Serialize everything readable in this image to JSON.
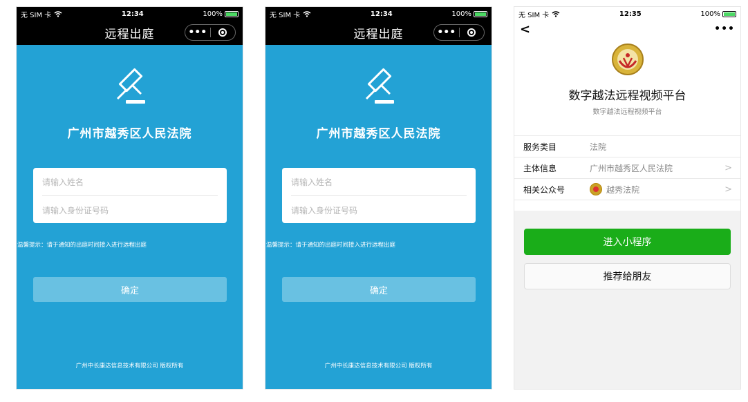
{
  "panels": [
    {
      "status": {
        "carrier": "无 SIM 卡",
        "time": "12:34",
        "battery": "100%"
      },
      "title": "远程出庭",
      "court": "广州市越秀区人民法院",
      "name_placeholder": "请输入姓名",
      "id_placeholder": "请输入身份证号码",
      "tip": "温馨提示：请于通知的出庭时间接入进行远程出庭",
      "confirm": "确定",
      "copyright": "广州中长康达信息技术有限公司 版权所有"
    },
    {
      "status": {
        "carrier": "无 SIM 卡",
        "time": "12:34",
        "battery": "100%"
      },
      "title": "远程出庭",
      "court": "广州市越秀区人民法院",
      "name_placeholder": "请输入姓名",
      "id_placeholder": "请输入身份证号码",
      "tip": "温馨提示：请于通知的出庭时间接入进行远程出庭",
      "confirm": "确定",
      "copyright": "广州中长康达信息技术有限公司 版权所有"
    }
  ],
  "profile": {
    "status": {
      "carrier": "无 SIM 卡",
      "time": "12:35",
      "battery": "100%"
    },
    "back": "<",
    "more": "•••",
    "app_name": "数字越法远程视频平台",
    "app_sub": "数字越法远程视频平台",
    "rows": [
      {
        "key": "服务类目",
        "value": "法院"
      },
      {
        "key": "主体信息",
        "value": "广州市越秀区人民法院"
      },
      {
        "key": "相关公众号",
        "value": "越秀法院"
      }
    ],
    "enter": "进入小程序",
    "share": "推荐给朋友"
  },
  "colors": {
    "court_blue": "#23a2d5",
    "wechat_green": "#1aad19"
  },
  "icons": [
    "wifi-icon",
    "battery-icon",
    "gavel-icon",
    "more-icon",
    "target-icon",
    "back-icon",
    "emblem-icon",
    "chevron-right-icon"
  ]
}
